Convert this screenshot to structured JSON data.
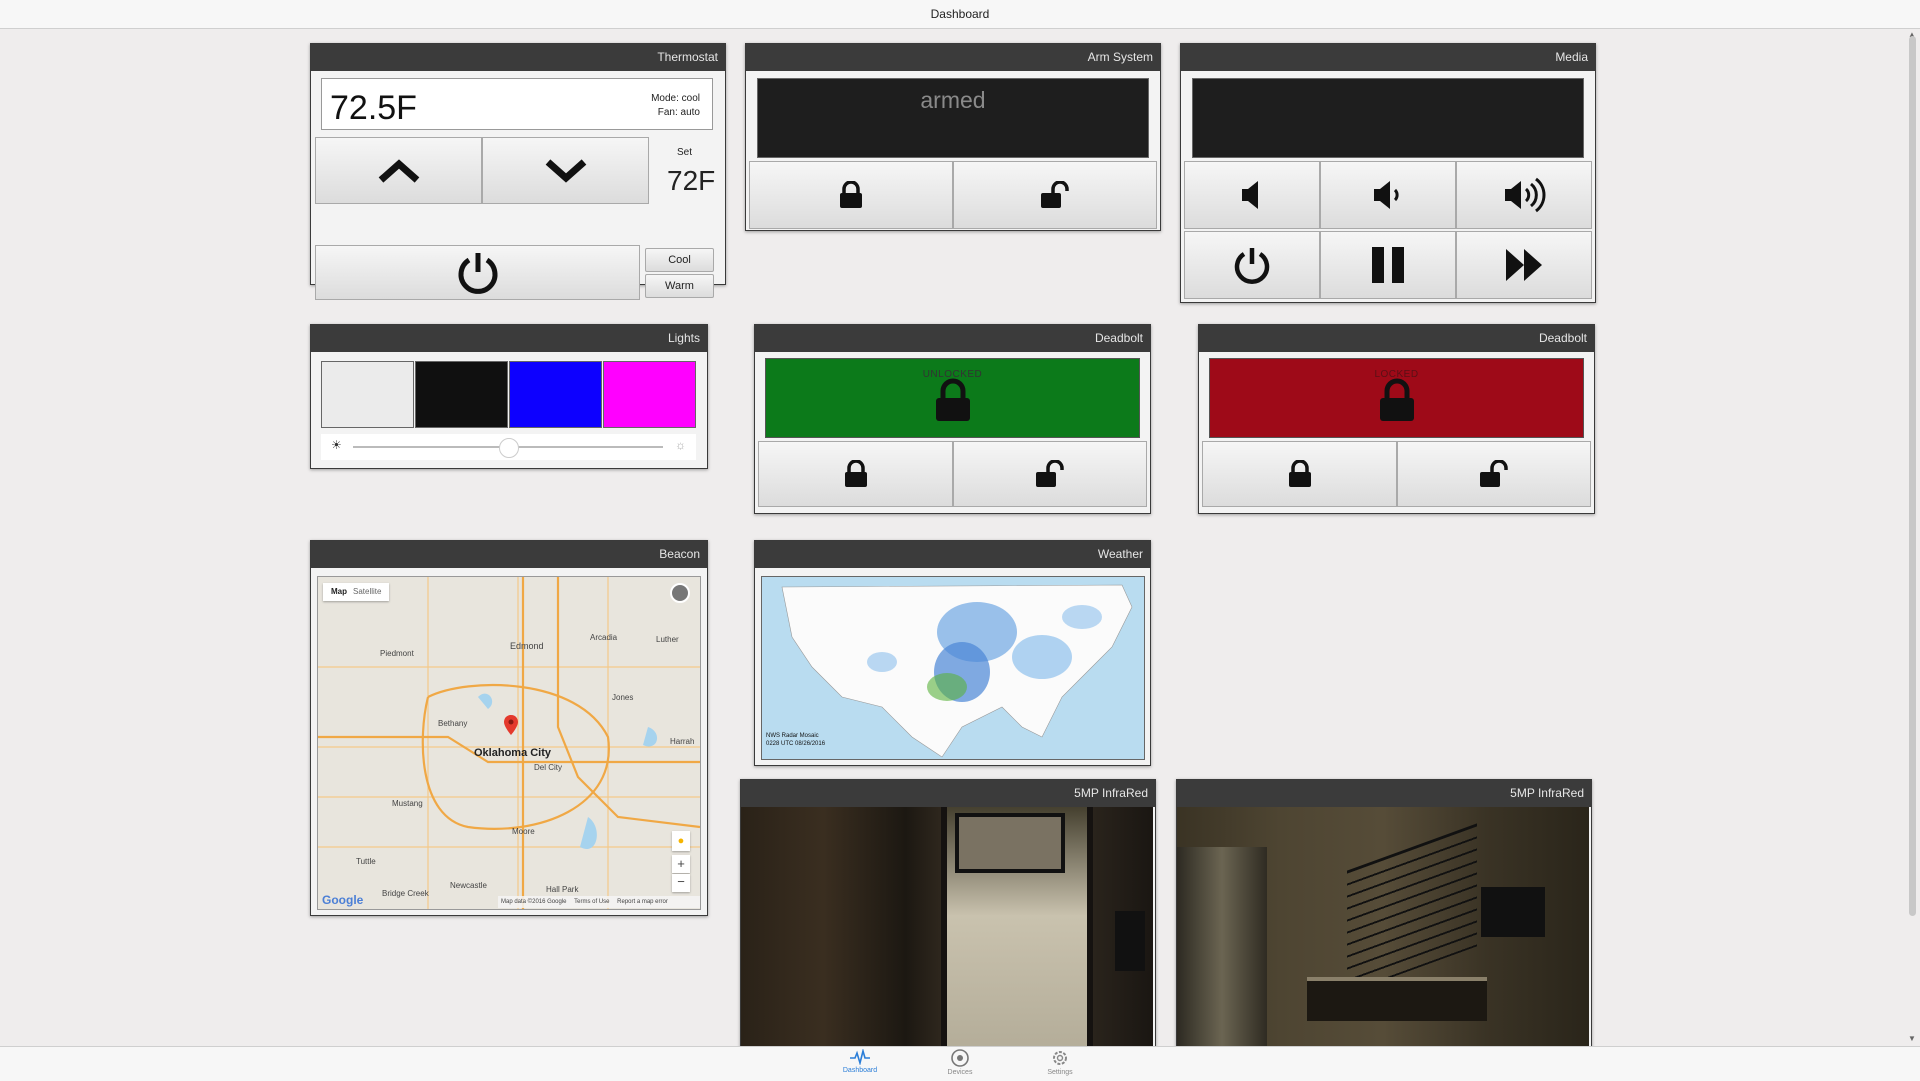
{
  "topbar": {
    "title": "Dashboard"
  },
  "thermostat": {
    "title": "Thermostat",
    "current_temp": "72.5F",
    "mode": "Mode: cool",
    "fan": "Fan: auto",
    "set_label": "Set",
    "set_temp": "72F",
    "cool_label": "Cool",
    "warm_label": "Warm"
  },
  "arm": {
    "title": "Arm System",
    "status": "armed"
  },
  "media": {
    "title": "Media"
  },
  "lights": {
    "title": "Lights",
    "colors": [
      "#ebebeb",
      "#101010",
      "#0d00ff",
      "#ff00ff"
    ],
    "brightness": 0.5
  },
  "deadbolt1": {
    "title": "Deadbolt",
    "status": "UNLOCKED",
    "color": "#0c7a1a"
  },
  "deadbolt2": {
    "title": "Deadbolt",
    "status": "LOCKED",
    "color": "#9e0a18"
  },
  "beacon": {
    "title": "Beacon",
    "map_tab": "Map",
    "satellite_tab": "Satellite",
    "city": "Oklahoma City",
    "places": [
      "Edmond",
      "Arcadia",
      "Luther",
      "Piedmont",
      "Jones",
      "Bethany",
      "Harrah",
      "Del City",
      "Mustang",
      "Moore",
      "Tuttle",
      "Newcastle",
      "Bridge Creek",
      "Hall Park"
    ],
    "attribution": "Map data ©2016 Google",
    "terms": "Terms of Use",
    "report": "Report a map error",
    "logo": "Google"
  },
  "weather": {
    "title": "Weather",
    "caption_line1": "NWS Radar Mosaic",
    "caption_line2": "0228 UTC 08/26/2016"
  },
  "camera1": {
    "title": "5MP InfraRed"
  },
  "camera2": {
    "title": "5MP InfraRed"
  },
  "nav": {
    "dashboard": "Dashboard",
    "devices": "Devices",
    "settings": "Settings"
  },
  "accent": "#2b7ed8"
}
